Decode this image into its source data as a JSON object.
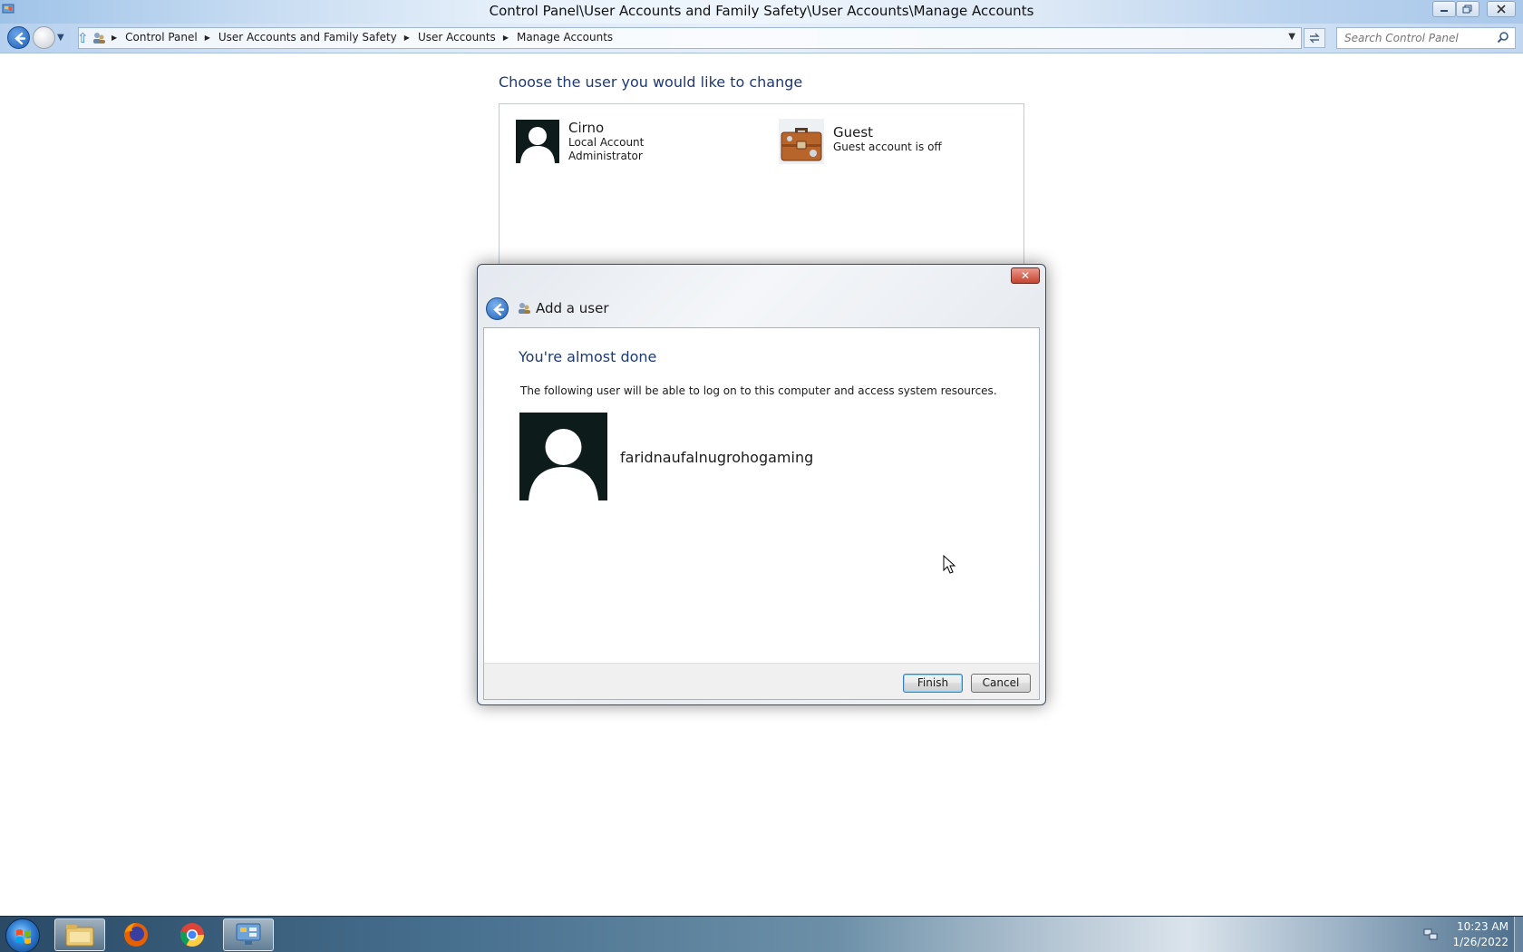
{
  "window": {
    "title": "Control Panel\\User Accounts and Family Safety\\User Accounts\\Manage Accounts"
  },
  "address": {
    "breadcrumbs": [
      "Control Panel",
      "User Accounts and Family Safety",
      "User Accounts",
      "Manage Accounts"
    ],
    "search_placeholder": "Search Control Panel"
  },
  "main": {
    "heading": "Choose the user you would like to change",
    "accounts": [
      {
        "name": "Cirno",
        "lines": [
          "Local Account",
          "Administrator"
        ],
        "icon": "user-silhouette-icon"
      },
      {
        "name": "Guest",
        "lines": [
          "Guest account is off"
        ],
        "icon": "briefcase-icon"
      }
    ]
  },
  "dialog": {
    "title": "Add a user",
    "heading": "You're almost done",
    "description": "The following user will be able to log on to this computer and access system resources.",
    "new_user_name": "faridnaufalnugrohogaming",
    "buttons": {
      "finish": "Finish",
      "cancel": "Cancel"
    },
    "close_label": "✕"
  },
  "taskbar": {
    "items": [
      "windows-explorer-icon",
      "firefox-icon",
      "chrome-icon",
      "control-panel-icon"
    ],
    "time": "10:23 AM",
    "date": "1/26/2022"
  },
  "colors": {
    "heading_blue": "#1e3a73",
    "avatar_bg": "#0d1b1a",
    "close_red": "#c7432f"
  }
}
